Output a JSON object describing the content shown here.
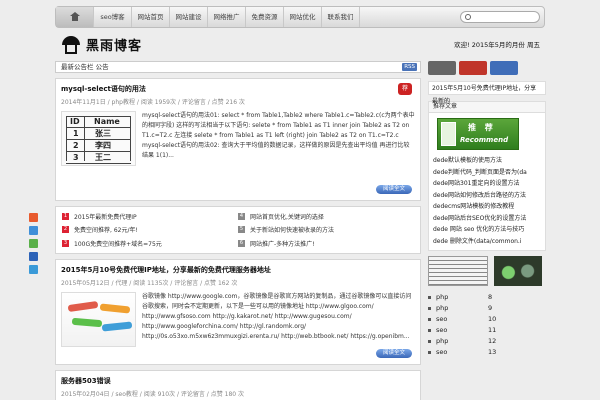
{
  "nav": {
    "items": [
      "seo博客",
      "网站首页",
      "网站建设",
      "网络推广",
      "免费资源",
      "网站优化",
      "联系我们"
    ]
  },
  "logo": {
    "text": "黑雨博客"
  },
  "header": {
    "date_text": "欢迎! 2015年5月的月份   周五"
  },
  "notice": {
    "text": "最新公告栏 公告",
    "rss_label": "RSS"
  },
  "posts": [
    {
      "title": "mysql-select语句的用法",
      "meta": "2014年11月1日 / php教程 / 阅读 1959次 / 评论留言 / 点赞 216 次",
      "badge": "荐",
      "thumb": {
        "header": [
          "ID",
          "Name"
        ],
        "rows": [
          [
            "1",
            "张三"
          ],
          [
            "2",
            "李四"
          ],
          [
            "3",
            "王二"
          ]
        ]
      },
      "excerpt": "mysql-select语句的用法01: select * from Table1,Table2 where Table1.c=Table2.c(c为两个表中的相同字段) 这样的写法相当于以下语句: selete * from Table1 as T1 inner join Table2 as T2 on T1.c=T2.c 左连接 selete * from Table1 as T1 left (right) join Table2 as T2 on T1.c=T2.c mysql-select语句的用法02: 查询大于平均值的数据记录，这样做的原因是先查出平均值 再进行比较 结果 1(1)...",
      "more": "阅读全文"
    },
    {
      "title": "2015年5月10号免费代理IP地址，分享最新的免费代理服务器地址",
      "meta": "2015年05月12日 / 代理 / 阅读 1135次 / 评论留言 / 点赞 162 次",
      "excerpt": "谷歌镜像 http://www.google.com，谷歌镜像是谷歌官方网站的复制品，通过谷歌镜像可以直接访问谷歌搜索，同时会不定期更新，以下是一些可以用的镜像地址 http://www.glgoo.com/ http://www.gfsoso.com http://g.kakarot.net/ http://www.gugesou.com/ http://www.googleforchina.com/ http://gl.randomk.org/ http://0s.o53xo.m5xw6z3mmuxgizi.erenta.ru/ http://web.btbook.net/ https://g.openibm...",
      "more": "阅读全文"
    },
    {
      "title": "服务器503错误",
      "meta": "2015年02月04日 / seo教程 / 阅读 910次 / 评论留言 / 点赞 180 次"
    }
  ],
  "links": [
    {
      "num": "1",
      "text": "2015年最新免费代理IP"
    },
    {
      "num": "4",
      "text": "网站首页优化,关键词的选择"
    },
    {
      "num": "2",
      "text": "免费空间推荐, 62元/年!"
    },
    {
      "num": "5",
      "text": "关于新站如何快速被收录的方法"
    },
    {
      "num": "3",
      "text": "100G免费空间推荐+域名=75元"
    },
    {
      "num": "6",
      "text": "网站推广-多种方法推广!"
    }
  ],
  "sidebar": {
    "tab_colors": [
      "#666666",
      "#c0352a",
      "#3f6db8"
    ],
    "latest_text": "2015年5月10号免费代理IP地址，分享最新的",
    "box_title": "推荐文章",
    "recommend": {
      "top": "推  荐",
      "bottom": "Recommend"
    },
    "list": [
      "dede默认模板的使用方法",
      "dede判断代码_判断页面是否为(da",
      "dede网站301重定向的设置方法",
      "dede网站如何修改后台路径的方法",
      "dedecms网站模板的修改教程",
      "dede网站后台SEO优化的设置方法",
      "dede 网站 seo 优化的方法与技巧",
      "dede 删除文件(data/common.i"
    ]
  },
  "tags": [
    [
      "php",
      "8"
    ],
    [
      "php",
      "9"
    ],
    [
      "seo",
      "10"
    ],
    [
      "seo",
      "11"
    ],
    [
      "php",
      "12"
    ],
    [
      "seo",
      "13"
    ]
  ],
  "share": {
    "colors": [
      "#e85a2d",
      "#3f8fd8",
      "#5ab04a",
      "#2d63b8",
      "#3a9ad8"
    ]
  }
}
